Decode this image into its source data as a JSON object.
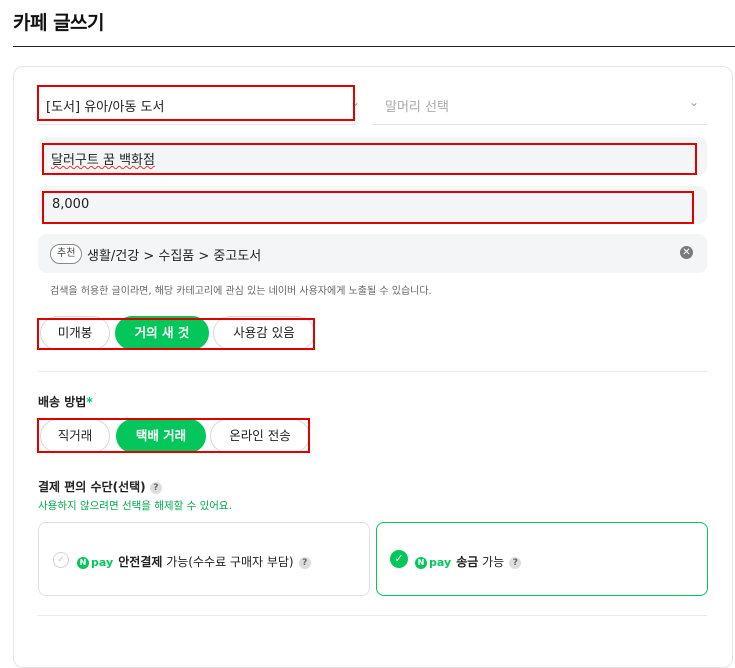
{
  "page": {
    "title": "카페 글쓰기"
  },
  "category_select": {
    "value": "[도서] 유아/아동 도서"
  },
  "prefix_select": {
    "placeholder": "말머리 선택"
  },
  "product_title": {
    "value": "달러구트 꿈 백화점"
  },
  "price": {
    "value": "8,000"
  },
  "category_suggestion": {
    "badge": "추천",
    "path": "생활/건강 > 수집품 > 중고도서"
  },
  "helper_text": "검색을 허용한 글이라면, 해당 카테고리에 관심 있는 네이버 사용자에게 노출될 수 있습니다.",
  "condition": {
    "options": [
      "미개봉",
      "거의 새 것",
      "사용감 있음"
    ],
    "selected": "거의 새 것"
  },
  "shipping": {
    "label": "배송 방법",
    "required_mark": "*",
    "options": [
      "직거래",
      "택배 거래",
      "온라인 전송"
    ],
    "selected": "택배 거래"
  },
  "payment": {
    "label": "결제 편의 수단(선택)",
    "hint": "사용하지 않으려면 선택을 해제할 수 있어요.",
    "options": [
      {
        "logo": "pay",
        "bold": "안전결제",
        "text": " 가능(수수료 구매자 부담)",
        "selected": false
      },
      {
        "logo": "pay",
        "bold": "송금",
        "text": " 가능",
        "selected": true
      }
    ]
  },
  "colors": {
    "accent": "#03c75a",
    "highlight_box": "#e00000"
  },
  "icons": {
    "dropdown": "chevron-down-icon",
    "clear": "clear-circle-icon",
    "help": "question-circle-icon",
    "check": "check-icon",
    "npay_n": "N"
  }
}
